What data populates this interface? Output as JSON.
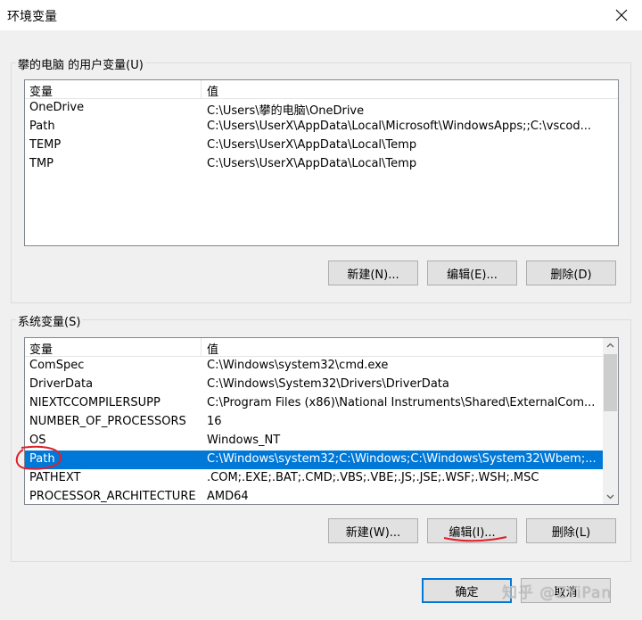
{
  "window": {
    "title": "环境变量",
    "close_icon": "close-icon"
  },
  "user_vars": {
    "group_label": "攀的电脑 的用户变量(U)",
    "header": {
      "variable": "变量",
      "value": "值"
    },
    "rows": [
      {
        "name": "OneDrive",
        "value": "C:\\Users\\攀的电脑\\OneDrive"
      },
      {
        "name": "Path",
        "value": "C:\\Users\\UserX\\AppData\\Local\\Microsoft\\WindowsApps;;C:\\vscod..."
      },
      {
        "name": "TEMP",
        "value": "C:\\Users\\UserX\\AppData\\Local\\Temp"
      },
      {
        "name": "TMP",
        "value": "C:\\Users\\UserX\\AppData\\Local\\Temp"
      }
    ],
    "buttons": {
      "new": "新建(N)...",
      "edit": "编辑(E)...",
      "delete": "删除(D)"
    }
  },
  "system_vars": {
    "group_label": "系统变量(S)",
    "header": {
      "variable": "变量",
      "value": "值"
    },
    "rows": [
      {
        "name": "ComSpec",
        "value": "C:\\Windows\\system32\\cmd.exe"
      },
      {
        "name": "DriverData",
        "value": "C:\\Windows\\System32\\Drivers\\DriverData"
      },
      {
        "name": "NIEXTCCOMPILERSUPP",
        "value": "C:\\Program Files (x86)\\National Instruments\\Shared\\ExternalCom..."
      },
      {
        "name": "NUMBER_OF_PROCESSORS",
        "value": "16"
      },
      {
        "name": "OS",
        "value": "Windows_NT"
      },
      {
        "name": "Path",
        "value": "C:\\Windows\\system32;C:\\Windows;C:\\Windows\\System32\\Wbem;..."
      },
      {
        "name": "PATHEXT",
        "value": ".COM;.EXE;.BAT;.CMD;.VBS;.VBE;.JS;.JSE;.WSF;.WSH;.MSC"
      },
      {
        "name": "PROCESSOR_ARCHITECTURE",
        "value": "AMD64"
      }
    ],
    "selected_row": 5,
    "buttons": {
      "new": "新建(W)...",
      "edit": "编辑(I)...",
      "delete": "删除(L)"
    }
  },
  "footer": {
    "ok": "确定",
    "cancel": "取消"
  },
  "watermark": "知乎 @ZYiPan",
  "colors": {
    "selection": "#0078d7",
    "annotation": "#e0202a"
  }
}
